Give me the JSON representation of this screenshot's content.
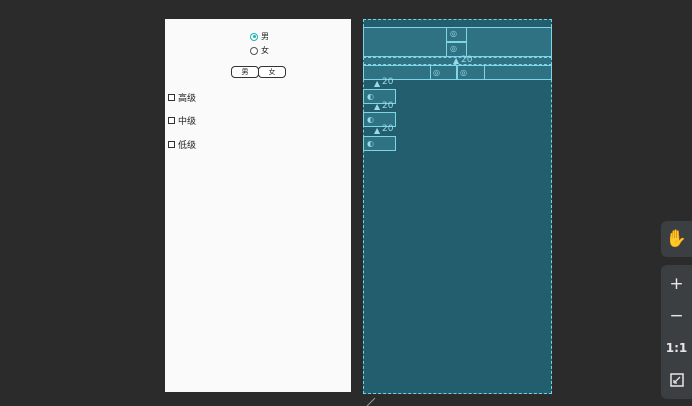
{
  "design": {
    "radios": [
      {
        "label": "男",
        "checked": true
      },
      {
        "label": "女",
        "checked": false
      }
    ],
    "buttons": [
      {
        "label": "男"
      },
      {
        "label": "女"
      }
    ],
    "checkboxes": [
      {
        "label": "高级",
        "checked": false
      },
      {
        "label": "中级",
        "checked": false
      },
      {
        "label": "低级",
        "checked": false
      }
    ]
  },
  "blueprint": {
    "labels": [
      "20",
      "20",
      "20",
      "20",
      "20"
    ]
  },
  "tools": {
    "hand_icon": "hand-icon",
    "zoom_in_label": "+",
    "zoom_out_label": "−",
    "actual_size_label": "1:1",
    "fit_icon": "fit-screen-icon"
  },
  "colors": {
    "accent": "#1fb3b3",
    "blueprint_bg": "#235e6e",
    "canvas_bg": "#2b2b2b"
  }
}
